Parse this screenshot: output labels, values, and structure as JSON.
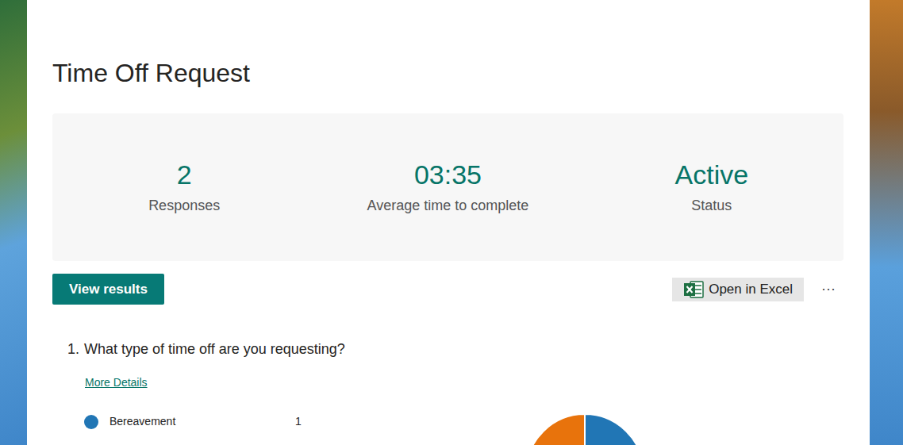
{
  "form": {
    "title": "Time Off Request"
  },
  "stats": [
    {
      "value": "2",
      "label": "Responses"
    },
    {
      "value": "03:35",
      "label": "Average time to complete"
    },
    {
      "value": "Active",
      "label": "Status"
    }
  ],
  "toolbar": {
    "view_results": "View results",
    "open_in_excel": "Open in Excel",
    "more": "···"
  },
  "questions": [
    {
      "number": "1.",
      "text": "What type of time off are you requesting?",
      "details_link": "More Details",
      "legend": [
        {
          "label": "Bereavement",
          "count": "1",
          "color": "#2176b5"
        }
      ],
      "chart": {
        "slices": [
          {
            "value": 1,
            "color": "#2176b5"
          },
          {
            "value": 1,
            "color": "#e8730c"
          }
        ]
      }
    }
  ]
}
